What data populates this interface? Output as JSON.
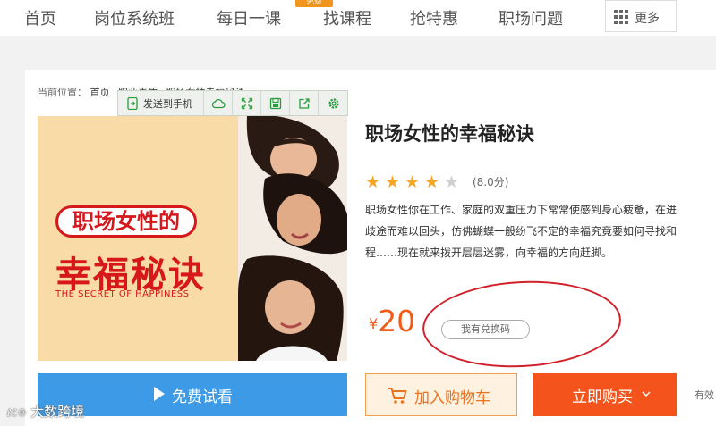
{
  "nav": {
    "items": [
      "首页",
      "岗位系统班",
      "每日一课",
      "找课程",
      "抢特惠",
      "职场问题"
    ],
    "badge": "免费",
    "more": "更多"
  },
  "breadcrumb": {
    "label": "当前位置：",
    "path": [
      "首页",
      "职业素质",
      "职场女性幸福秘诀"
    ]
  },
  "toolbar": {
    "send": "发送到手机",
    "icons": [
      "phone-send-icon",
      "cloud-icon",
      "fullscreen-icon",
      "save-icon",
      "share-icon",
      "settings-icon"
    ]
  },
  "cover": {
    "title1": "职场女性的",
    "title2": "幸福秘诀",
    "subtitle": "THE SECRET OF HAPPINESS"
  },
  "course": {
    "title": "职场女性的幸福秘诀",
    "rating": 4,
    "rating_max": 5,
    "score": "(8.0分)",
    "desc": [
      "职场女性你在工作、家庭的双重压力下常常使感到身心疲惫，在进",
      "歧途而难以回头，仿佛蝴蝶一般纷飞不定的幸福究竟要如何寻找和",
      "程……现在就来拨开层层迷雾，向幸福的方向赶脚。"
    ],
    "currency": "¥",
    "price": "20",
    "redeem": "我有兑换码"
  },
  "buttons": {
    "trial": "免费试看",
    "cart": "加入购物车",
    "buy": "立即购买",
    "valid": "有效"
  },
  "watermark": {
    "logo": "ℓℰ℗",
    "text": "大数跨境"
  },
  "colors": {
    "accent_orange": "#f4541c",
    "price": "#f25c19",
    "trial_blue": "#3d9ae6",
    "cover_red": "#d6181c",
    "annotation_red": "#d2202a",
    "star": "#f5a623"
  }
}
